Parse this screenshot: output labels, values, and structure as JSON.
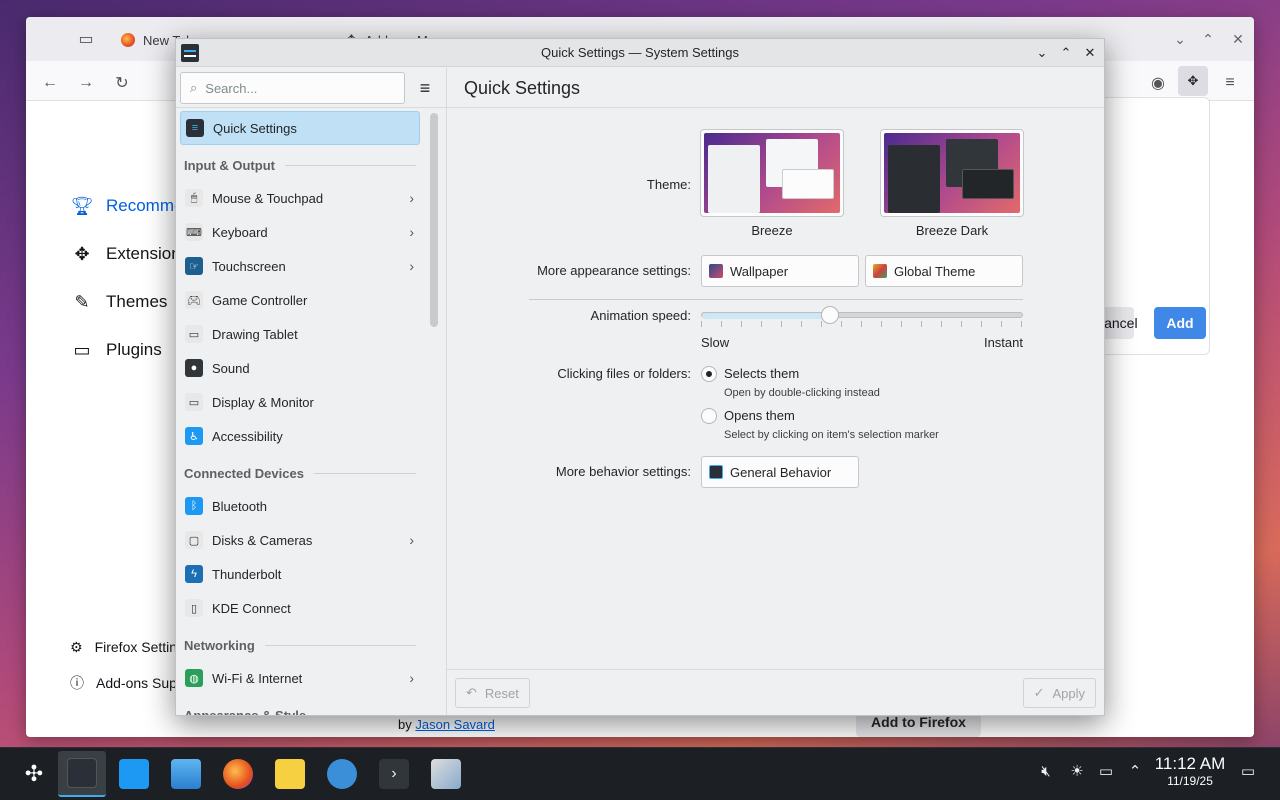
{
  "firefox": {
    "tab1_label": "New Tab",
    "tab2_label": "Add-ons M",
    "sidebar": [
      {
        "label": "Recommendations",
        "icon": "trophy-icon"
      },
      {
        "label": "Extensions",
        "icon": "puzzle-icon"
      },
      {
        "label": "Themes",
        "icon": "brush-icon"
      },
      {
        "label": "Plugins",
        "icon": "plugin-icon"
      }
    ],
    "bottom_links": [
      {
        "label": "Firefox Settings",
        "icon": "gear-icon"
      },
      {
        "label": "Add-ons Support",
        "icon": "help-icon"
      }
    ],
    "cancel_label": "Cancel",
    "add_label": "Add",
    "by_prefix": "by",
    "author": "Jason Savard",
    "add_to_firefox": "Add to Firefox"
  },
  "window": {
    "title": "Quick Settings — System Settings"
  },
  "search": {
    "placeholder": "Search..."
  },
  "page": {
    "title": "Quick Settings"
  },
  "sidebar": {
    "active": "Quick Settings",
    "groups": [
      {
        "heading": "Input & Output",
        "items": [
          {
            "label": "Mouse & Touchpad",
            "icon": "mouse-icon",
            "chevron": true
          },
          {
            "label": "Keyboard",
            "icon": "keyboard-icon",
            "chevron": true
          },
          {
            "label": "Touchscreen",
            "icon": "touchscreen-icon",
            "chevron": true
          },
          {
            "label": "Game Controller",
            "icon": "gamepad-icon",
            "chevron": false
          },
          {
            "label": "Drawing Tablet",
            "icon": "tablet-icon",
            "chevron": false
          },
          {
            "label": "Sound",
            "icon": "speaker-icon",
            "chevron": false
          },
          {
            "label": "Display & Monitor",
            "icon": "monitor-icon",
            "chevron": false
          },
          {
            "label": "Accessibility",
            "icon": "accessibility-icon",
            "chevron": false
          }
        ]
      },
      {
        "heading": "Connected Devices",
        "items": [
          {
            "label": "Bluetooth",
            "icon": "bluetooth-icon",
            "chevron": false
          },
          {
            "label": "Disks & Cameras",
            "icon": "disk-icon",
            "chevron": true
          },
          {
            "label": "Thunderbolt",
            "icon": "thunderbolt-icon",
            "chevron": false
          },
          {
            "label": "KDE Connect",
            "icon": "phone-icon",
            "chevron": false
          }
        ]
      },
      {
        "heading": "Networking",
        "items": [
          {
            "label": "Wi-Fi & Internet",
            "icon": "globe-icon",
            "chevron": true
          }
        ]
      },
      {
        "heading": "Appearance & Style",
        "items": []
      }
    ]
  },
  "quick": {
    "theme_label": "Theme:",
    "themes": [
      {
        "name": "Breeze",
        "style": "light"
      },
      {
        "name": "Breeze Dark",
        "style": "dark"
      }
    ],
    "appearance_label": "More appearance settings:",
    "wallpaper_btn": "Wallpaper",
    "global_theme_btn": "Global Theme",
    "animation_label": "Animation speed:",
    "animation_value_fraction": 0.4,
    "slow": "Slow",
    "instant": "Instant",
    "clicking_label": "Clicking files or folders:",
    "opt1": "Selects them",
    "opt1_desc": "Open by double-clicking instead",
    "opt2": "Opens them",
    "opt2_desc": "Select by clicking on item's selection marker",
    "selected_option": 1,
    "behavior_label": "More behavior settings:",
    "general_behavior_btn": "General Behavior"
  },
  "footer": {
    "reset": "Reset",
    "apply": "Apply"
  },
  "taskbar": {
    "time": "11:12 AM",
    "date": "11/19/25",
    "apps": [
      "launcher-icon",
      "settings-icon",
      "discover-icon",
      "files-icon",
      "firefox-icon",
      "notes-icon",
      "browser-icon",
      "terminal-icon",
      "image-viewer-icon"
    ],
    "tray": [
      "volume-muted-icon",
      "brightness-icon",
      "display-icon",
      "expand-tray-icon"
    ]
  },
  "colors": {
    "accent": "#3daee9",
    "selection": "#bfe0f5",
    "firefox_blue": "#0061e0"
  }
}
